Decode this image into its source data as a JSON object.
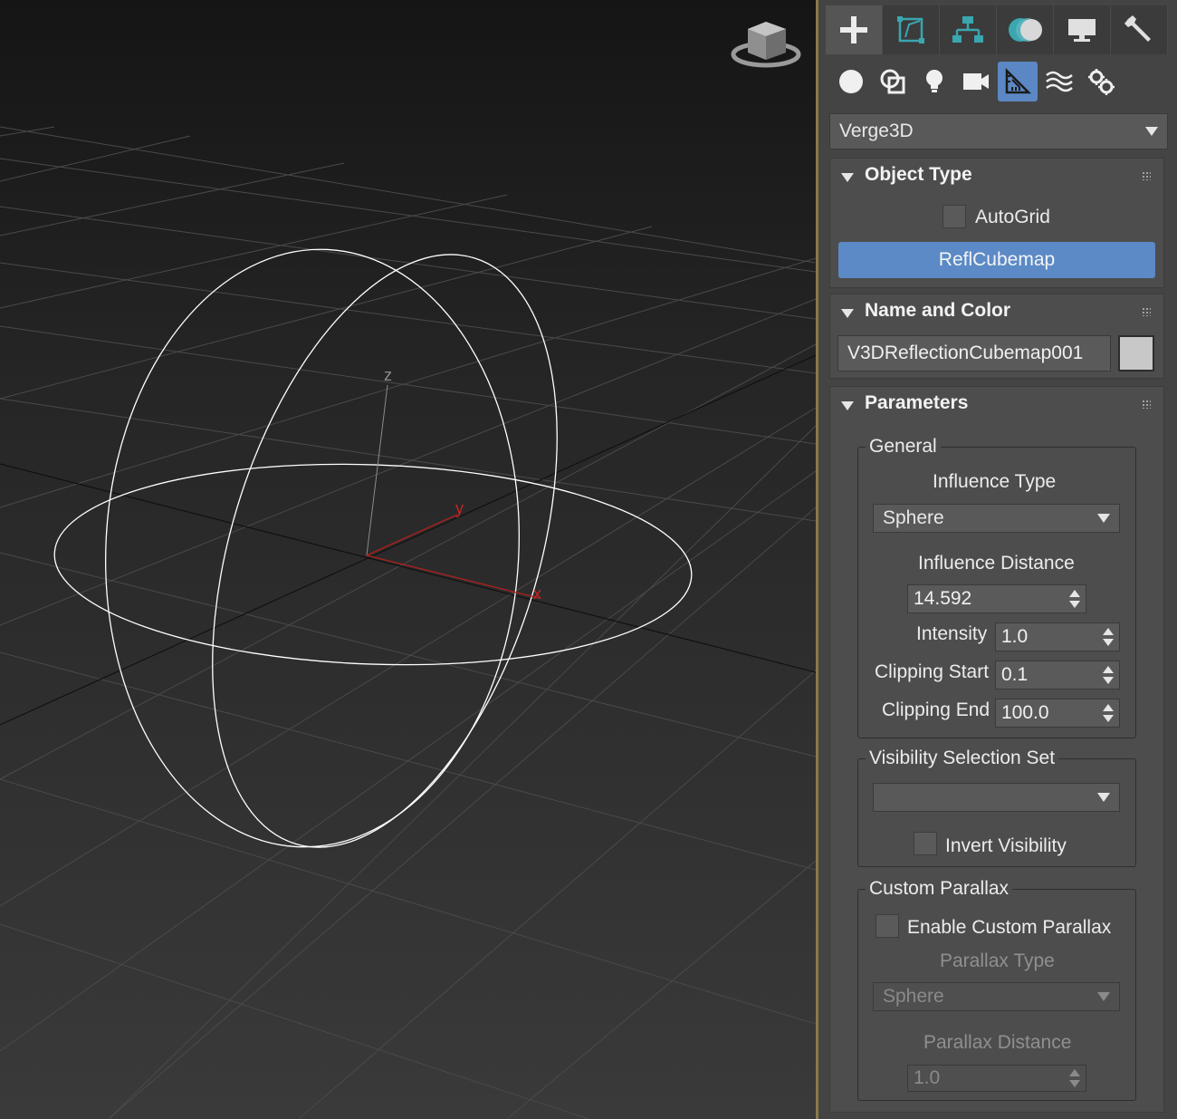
{
  "viewport": {
    "axis_labels": {
      "x": "x",
      "y": "y",
      "z": "z"
    },
    "colors": {
      "wire": "#ffffff",
      "axis_x": "#b02020",
      "axis_y": "#b02020",
      "axis_z": "#8c8c8c",
      "grid": "#4a4a4a"
    }
  },
  "command_panel": {
    "tabs": [
      {
        "name": "create-tab",
        "icon": "plus-icon",
        "active": true
      },
      {
        "name": "modify-tab",
        "icon": "modify-icon"
      },
      {
        "name": "hierarchy-tab",
        "icon": "hierarchy-icon"
      },
      {
        "name": "motion-tab",
        "icon": "motion-icon"
      },
      {
        "name": "display-tab",
        "icon": "display-icon"
      },
      {
        "name": "utilities-tab",
        "icon": "wrench-icon"
      }
    ],
    "categories": [
      {
        "name": "geometry",
        "icon": "sphere-icon"
      },
      {
        "name": "shapes",
        "icon": "shapes-icon"
      },
      {
        "name": "lights",
        "icon": "lightbulb-icon"
      },
      {
        "name": "cameras",
        "icon": "camera-icon"
      },
      {
        "name": "helpers",
        "icon": "helper-ruler-icon",
        "active": true
      },
      {
        "name": "space-warps",
        "icon": "spacewarp-icon"
      },
      {
        "name": "systems",
        "icon": "systems-icon"
      }
    ],
    "category_dropdown": "Verge3D",
    "object_type": {
      "title": "Object Type",
      "autogrid_label": "AutoGrid",
      "button_label": "ReflCubemap"
    },
    "name_and_color": {
      "title": "Name and Color",
      "name_value": "V3DReflectionCubemap001",
      "color": "#c8c8c8"
    },
    "parameters": {
      "title": "Parameters",
      "general": {
        "title": "General",
        "influence_type_label": "Influence Type",
        "influence_type_value": "Sphere",
        "influence_distance_label": "Influence Distance",
        "influence_distance_value": "14.592",
        "intensity_label": "Intensity",
        "intensity_value": "1.0",
        "clip_start_label": "Clipping Start",
        "clip_start_value": "0.1",
        "clip_end_label": "Clipping End",
        "clip_end_value": "100.0"
      },
      "visibility": {
        "title": "Visibility Selection Set",
        "selection_value": "",
        "invert_label": "Invert Visibility"
      },
      "parallax": {
        "title": "Custom Parallax",
        "enable_label": "Enable Custom Parallax",
        "type_label": "Parallax Type",
        "type_value": "Sphere",
        "distance_label": "Parallax Distance",
        "distance_value": "1.0"
      }
    }
  }
}
